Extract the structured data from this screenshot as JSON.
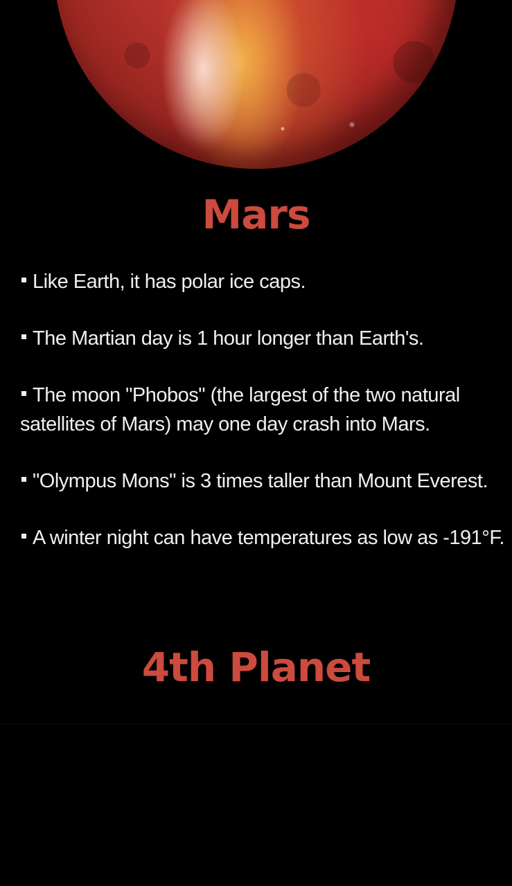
{
  "title": "Mars",
  "facts": [
    "Like Earth, it has polar ice caps.",
    "The Martian day is 1 hour longer than Earth's.",
    "The moon \"Phobos\" (the largest of the two natural satellites of Mars) may one day crash into Mars.",
    "\"Olympus Mons\" is 3 times taller than Mount Everest.",
    "A winter night can have temperatures as low as -191°F."
  ],
  "subtitle": "4th Planet",
  "colors": {
    "background": "#000000",
    "accent": "#cc4a3e",
    "text": "#f0f0f0"
  },
  "images": {
    "planet": "mars-planet-illustration"
  }
}
